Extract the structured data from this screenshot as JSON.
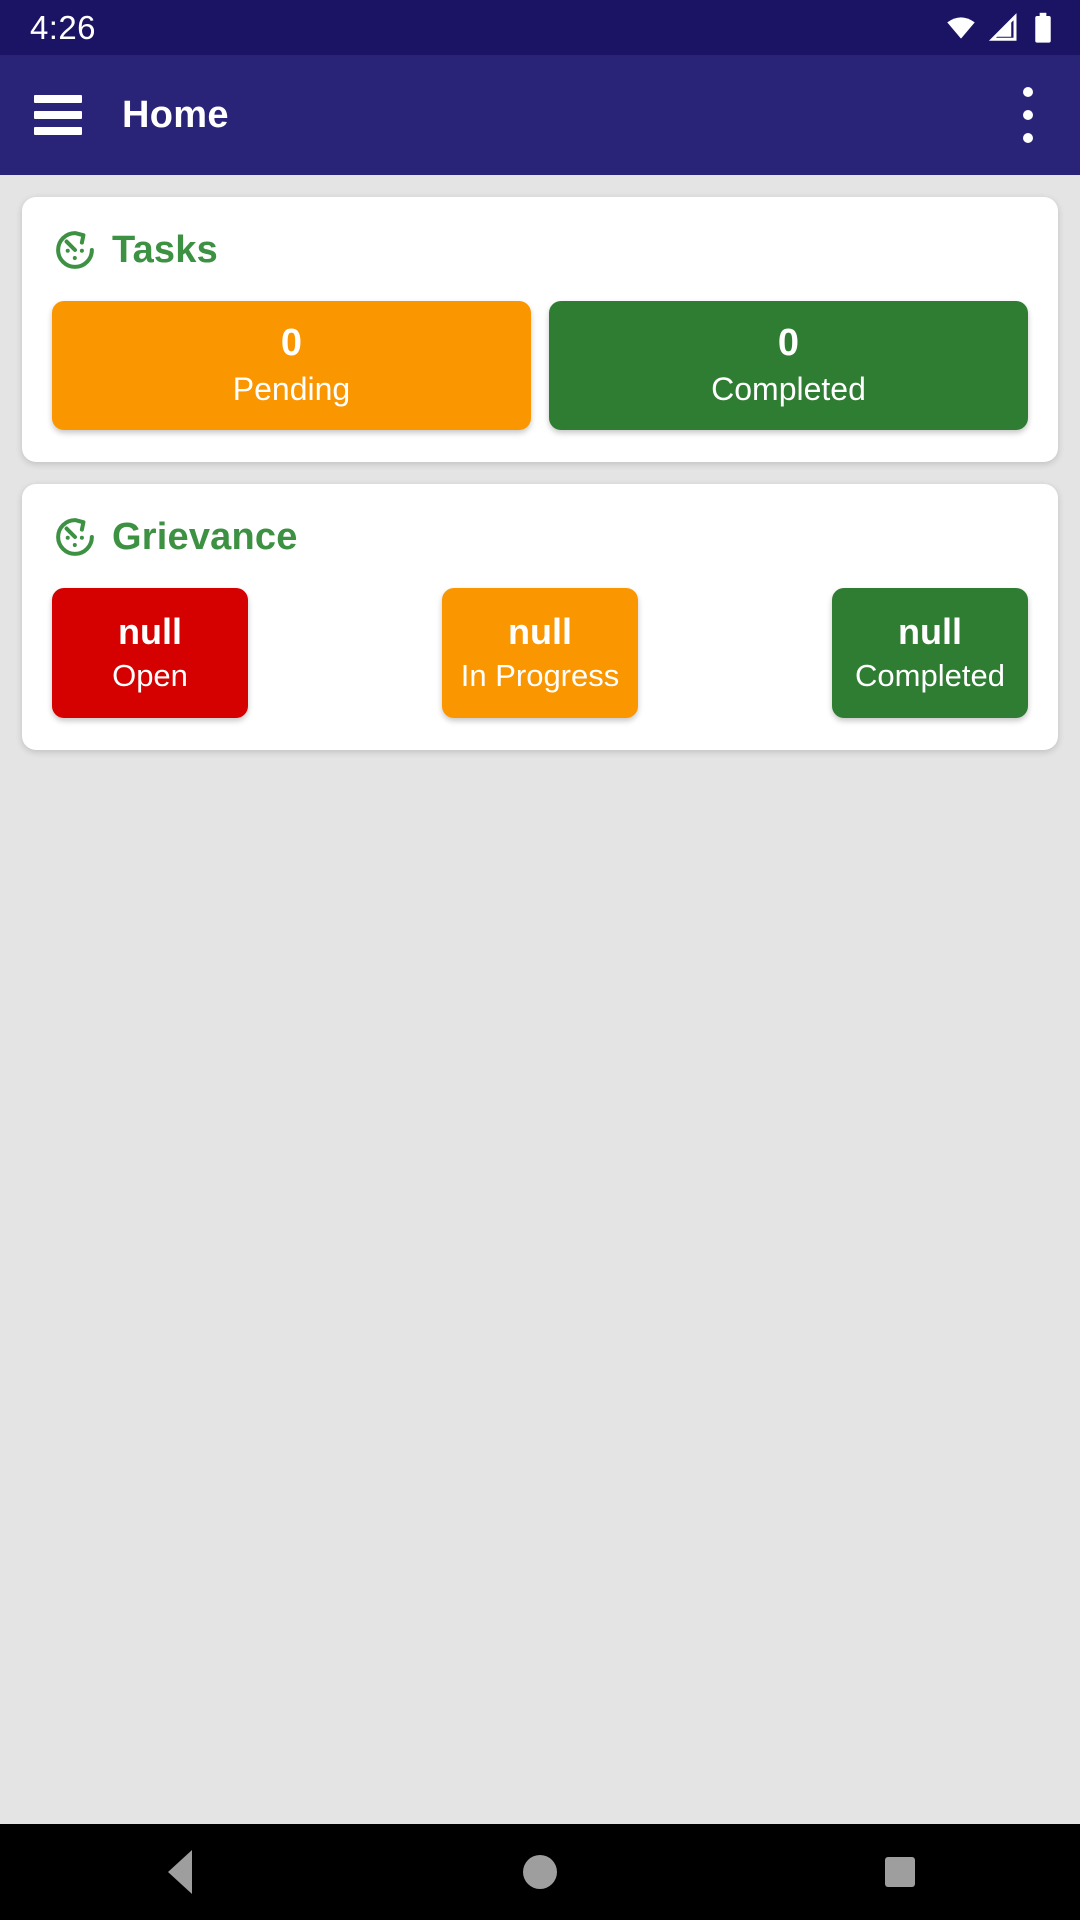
{
  "status_bar": {
    "clock": "4:26",
    "icons": [
      "wifi-icon",
      "cellular-signal-icon",
      "battery-icon"
    ],
    "background": "#1b1464"
  },
  "app_bar": {
    "menu_icon": "hamburger-menu-icon",
    "title": "Home",
    "overflow_icon": "more-vertical-icon",
    "background": "#2a2478"
  },
  "cards": [
    {
      "icon": "pace-timer-icon",
      "title": "Tasks",
      "title_color": "#3d9142",
      "tiles": [
        {
          "value": "0",
          "label": "Pending",
          "color": "#fa9600"
        },
        {
          "value": "0",
          "label": "Completed",
          "color": "#2e7d32"
        }
      ]
    },
    {
      "icon": "pace-timer-icon",
      "title": "Grievance",
      "title_color": "#3d9142",
      "tiles": [
        {
          "value": "null",
          "label": "Open",
          "color": "#d50000"
        },
        {
          "value": "null",
          "label": "In Progress",
          "color": "#fa9600"
        },
        {
          "value": "null",
          "label": "Completed",
          "color": "#2e7d32"
        }
      ]
    }
  ],
  "nav_bar": {
    "back_label": "back-button",
    "home_label": "home-button",
    "recents_label": "recents-button",
    "background": "#000000"
  }
}
